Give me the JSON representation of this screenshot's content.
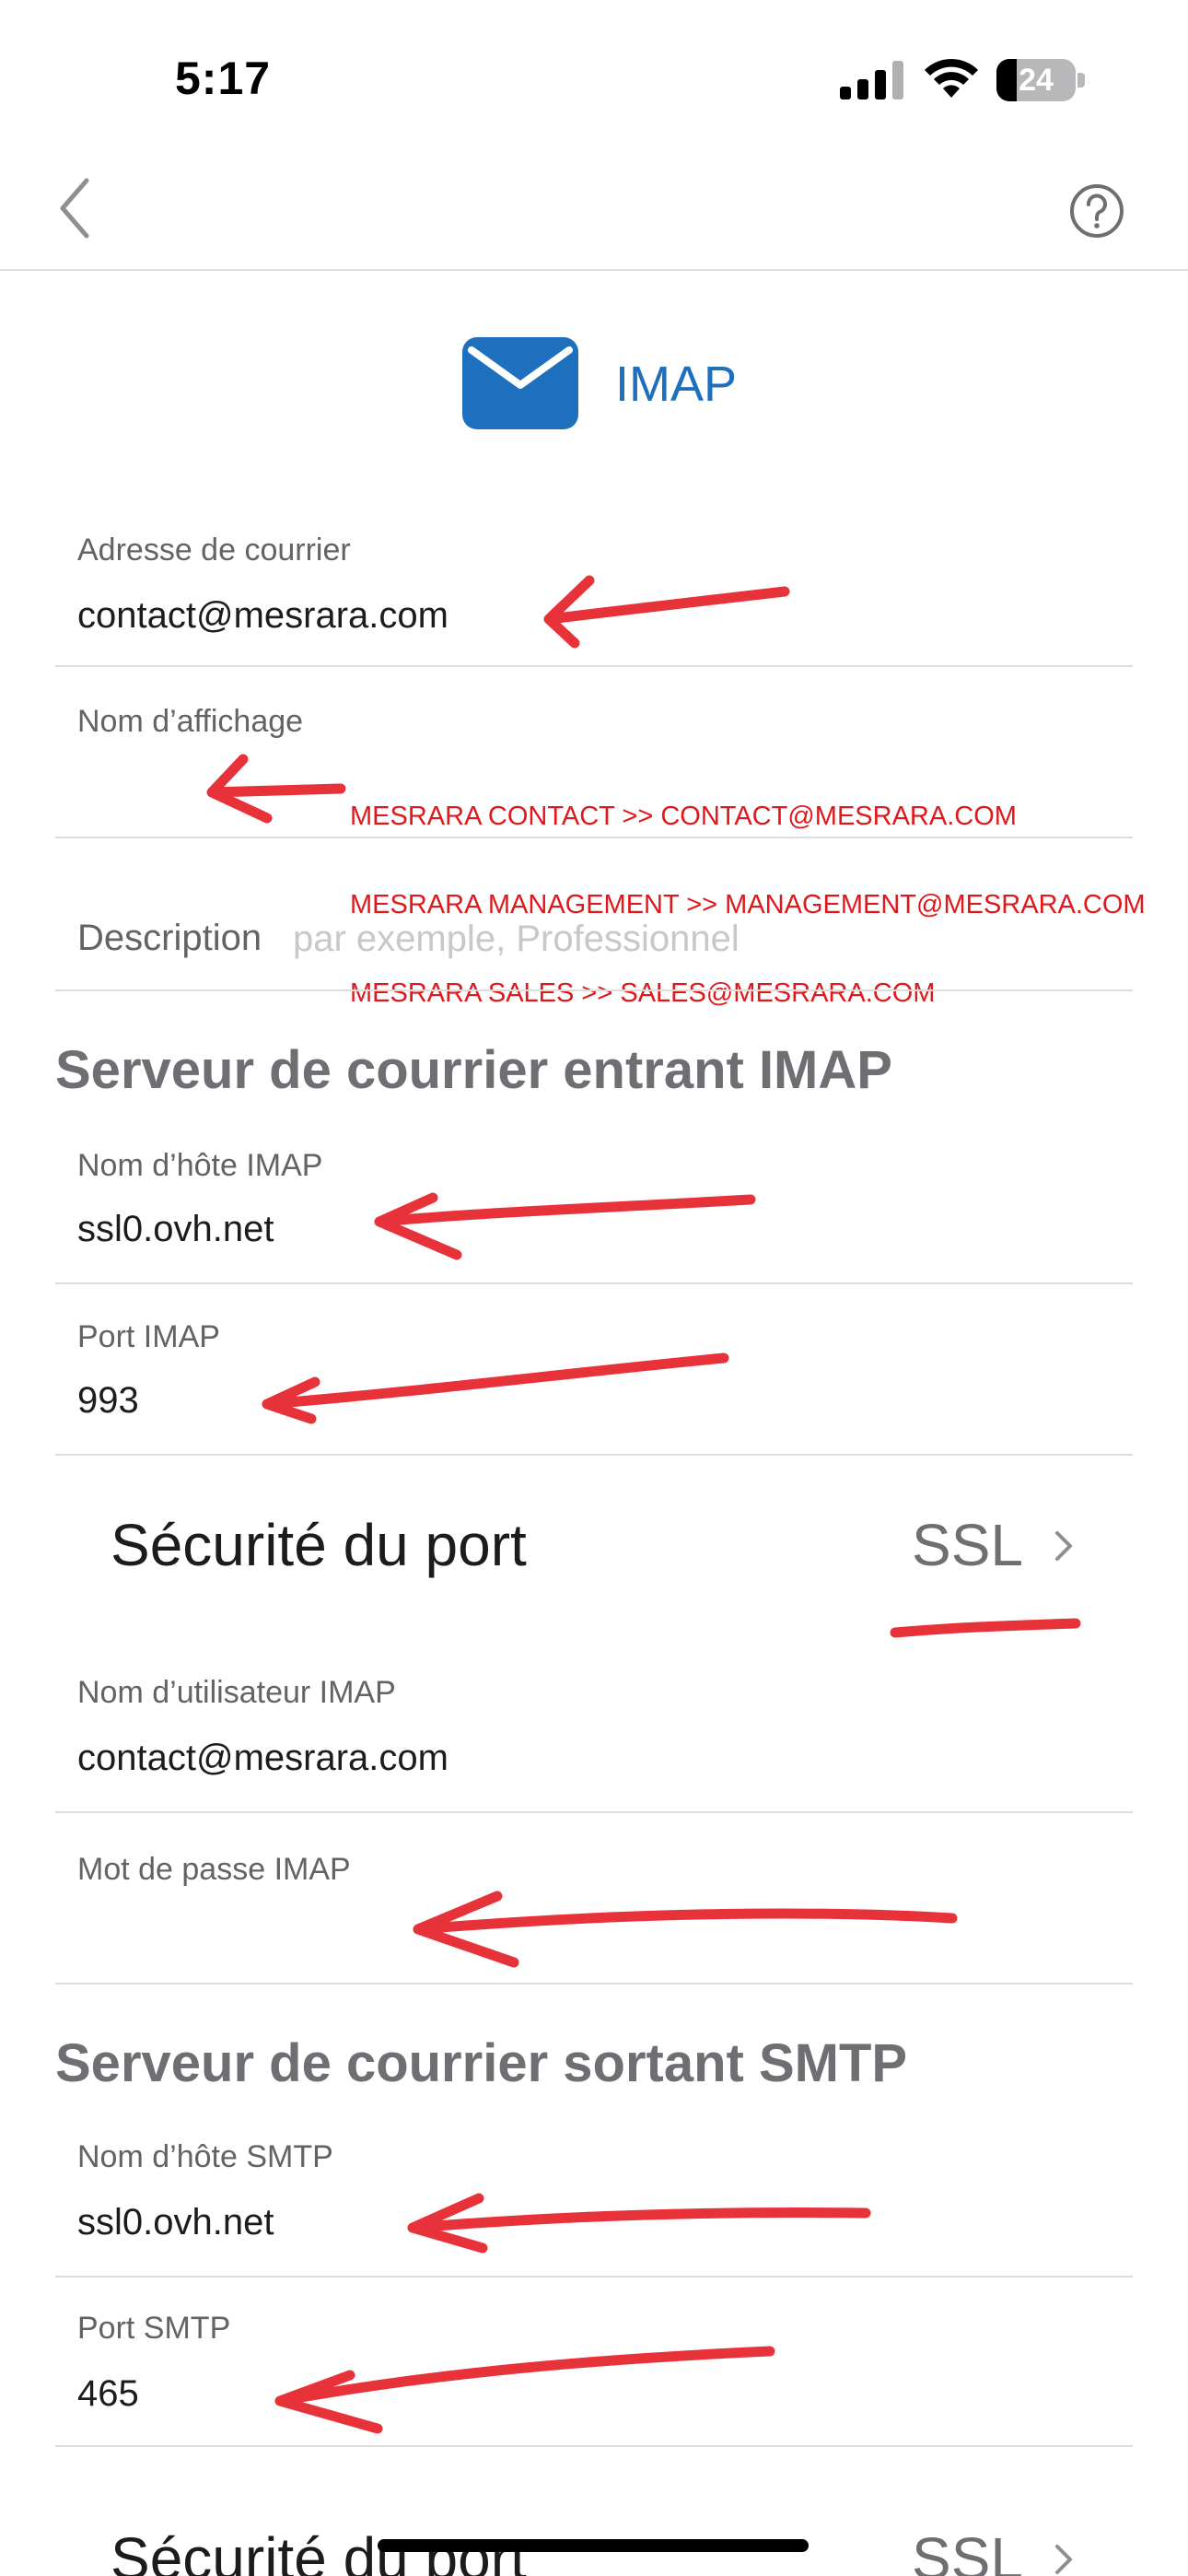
{
  "status_bar": {
    "time": "5:17",
    "battery": "24"
  },
  "nav": {
    "back_icon": "chevron-left-icon",
    "help_icon": "question-circle-icon"
  },
  "header": {
    "icon": "envelope-icon",
    "title": "IMAP",
    "accent": "#1f6fbf"
  },
  "account": {
    "email_label": "Adresse de courrier",
    "email_value": "contact@mesrara.com",
    "display_name_label": "Nom d’affichage",
    "display_name_value": "",
    "description_label": "Description",
    "description_placeholder": "par exemple, Professionnel"
  },
  "annotation": {
    "color": "#e0181b",
    "lines": [
      "MESRARA CONTACT >> CONTACT@MESRARA.COM",
      "MESRARA MANAGEMENT >> MANAGEMENT@MESRARA.COM",
      "MESRARA SALES >> SALES@MESRARA.COM"
    ]
  },
  "incoming": {
    "section_title": "Serveur de courrier entrant IMAP",
    "host_label": "Nom d’hôte IMAP",
    "host_value": "ssl0.ovh.net",
    "port_label": "Port IMAP",
    "port_value": "993",
    "security_label": "Sécurité du port",
    "security_value": "SSL",
    "username_label": "Nom d’utilisateur IMAP",
    "username_value": "contact@mesrara.com",
    "password_label": "Mot de passe IMAP",
    "password_value": ""
  },
  "outgoing": {
    "section_title": "Serveur de courrier sortant SMTP",
    "host_label": "Nom d’hôte SMTP",
    "host_value": "ssl0.ovh.net",
    "port_label": "Port SMTP",
    "port_value": "465",
    "security_label": "Sécurité du port",
    "security_value": "SSL"
  }
}
